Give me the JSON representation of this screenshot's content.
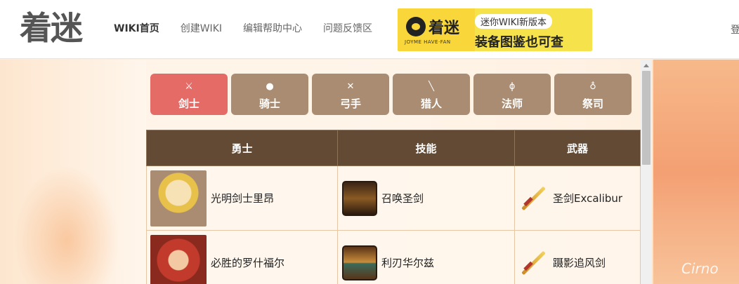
{
  "header": {
    "logo_text": "着迷",
    "nav": [
      {
        "label": "WIKI首页",
        "active": true
      },
      {
        "label": "创建WIKI",
        "active": false
      },
      {
        "label": "编辑帮助中心",
        "active": false
      },
      {
        "label": "问题反馈区",
        "active": false
      }
    ],
    "banner": {
      "brand": "着迷",
      "sub": "JOYME HAVE·FAN",
      "tag": "迷你WIKI新版本",
      "headline": "装备图鉴也可查"
    },
    "login_label": "登"
  },
  "tabs": [
    {
      "label": "剑士",
      "icon": "sword-icon",
      "active": true
    },
    {
      "label": "骑士",
      "icon": "helmet-icon",
      "active": false
    },
    {
      "label": "弓手",
      "icon": "bow-icon",
      "active": false
    },
    {
      "label": "猎人",
      "icon": "dagger-icon",
      "active": false
    },
    {
      "label": "法师",
      "icon": "staff-icon",
      "active": false
    },
    {
      "label": "祭司",
      "icon": "ankh-icon",
      "active": false
    }
  ],
  "table": {
    "headers": [
      "勇士",
      "技能",
      "武器"
    ],
    "rows": [
      {
        "hero": "光明剑士里昂",
        "skill": "召唤圣剑",
        "weapon": "圣剑Excalibur"
      },
      {
        "hero": "必胜的罗什福尔",
        "skill": "利刃华尔兹",
        "weapon": "蹑影追风剑"
      }
    ]
  },
  "background_text": "Cirno",
  "colors": {
    "tab_active": "#e46b66",
    "tab_inactive": "#a98c72",
    "table_header": "#634a34",
    "banner_yellow": "#f6e24a"
  }
}
